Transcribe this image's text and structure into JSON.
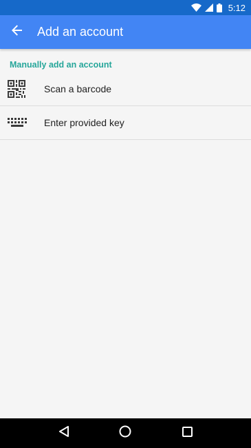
{
  "status_bar": {
    "time": "5:12",
    "icons": [
      "wifi-icon",
      "signal-icon",
      "battery-icon"
    ],
    "color": "#1669c9"
  },
  "app_bar": {
    "title": "Add an account",
    "back_icon": "arrow-back-icon",
    "color": "#4285f4"
  },
  "content": {
    "section_header": "Manually add an account",
    "section_color": "#26a69a",
    "items": [
      {
        "label": "Scan a barcode",
        "icon": "qr-code-icon"
      },
      {
        "label": "Enter provided key",
        "icon": "keyboard-icon"
      }
    ]
  },
  "nav_bar": {
    "buttons": [
      "back-triangle-icon",
      "home-circle-icon",
      "recents-square-icon"
    ]
  }
}
